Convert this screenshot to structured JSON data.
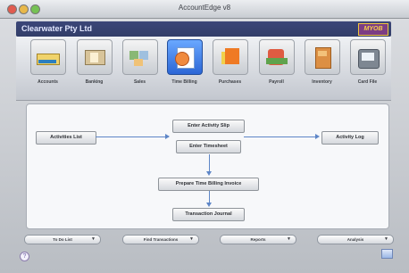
{
  "window": {
    "title": "AccountEdge v8"
  },
  "header": {
    "company_name": "Clearwater Pty Ltd",
    "brand": "MYOB"
  },
  "commands": [
    {
      "label": "Accounts",
      "icon": "accounts-icon",
      "active": false
    },
    {
      "label": "Banking",
      "icon": "banking-icon",
      "active": false
    },
    {
      "label": "Sales",
      "icon": "sales-icon",
      "active": false
    },
    {
      "label": "Time Billing",
      "icon": "time-billing-icon",
      "active": true
    },
    {
      "label": "Purchases",
      "icon": "purchases-icon",
      "active": false
    },
    {
      "label": "Payroll",
      "icon": "payroll-icon",
      "active": false
    },
    {
      "label": "Inventory",
      "icon": "inventory-icon",
      "active": false
    },
    {
      "label": "Card File",
      "icon": "card-file-icon",
      "active": false
    }
  ],
  "flow": {
    "activities_list": "Activities List",
    "enter_activity_slip": "Enter Activity Slip",
    "enter_timesheet": "Enter Timesheet",
    "activity_log": "Activity Log",
    "prepare_invoice": "Prepare Time Billing Invoice",
    "transaction_journal": "Transaction Journal"
  },
  "bottom_menus": [
    {
      "label": "To Do List"
    },
    {
      "label": "Find Transactions"
    },
    {
      "label": "Reports"
    },
    {
      "label": "Analysis"
    }
  ],
  "colors": {
    "accent": "#2b66d6",
    "arrow": "#5e86c7",
    "brand": "#7c3d84"
  }
}
